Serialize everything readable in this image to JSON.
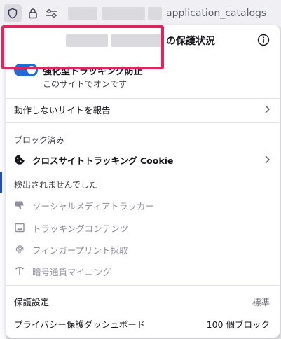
{
  "urlbar": {
    "url_suffix": "application_catalogs"
  },
  "panel": {
    "title": "の保護状況",
    "etp": {
      "title": "強化型トラッキング防止",
      "subtitle": "このサイトでオンです",
      "enabled": true
    },
    "report_site": "動作しないサイトを報告",
    "blocked_heading": "ブロック済み",
    "blocked_items": [
      {
        "label": "クロスサイトトラッキング Cookie",
        "icon": "cookie-icon"
      }
    ],
    "not_detected_heading": "検出されませんでした",
    "not_detected_items": [
      {
        "label": "ソーシャルメディアトラッカー",
        "icon": "thumbs-down-icon"
      },
      {
        "label": "トラッキングコンテンツ",
        "icon": "image-icon"
      },
      {
        "label": "フィンガープリント採取",
        "icon": "fingerprint-icon"
      },
      {
        "label": "暗号通貨マイニング",
        "icon": "pickaxe-icon"
      }
    ],
    "footer": {
      "protection_settings": "保護設定",
      "protection_level": "標準",
      "dashboard": "プライバシー保護ダッシュボード",
      "blocked_count": "100 個ブロック"
    }
  },
  "colors": {
    "toggle": "#1f6bd6",
    "highlight": "#e0245e"
  }
}
